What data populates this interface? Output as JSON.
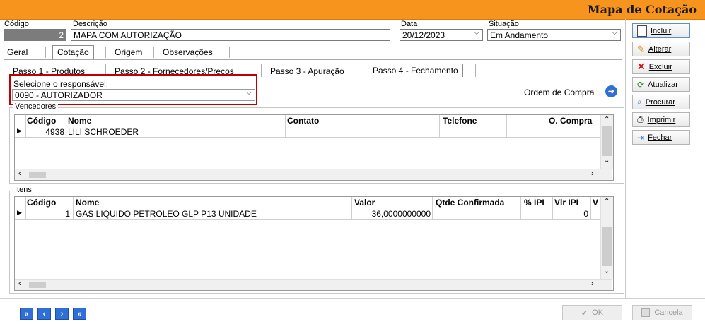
{
  "window": {
    "title": "Mapa de Cotação"
  },
  "header": {
    "codigo_label": "Código",
    "codigo_value": "2",
    "descricao_label": "Descrição",
    "descricao_value": "MAPA COM AUTORIZAÇÃO",
    "data_label": "Data",
    "data_value": "20/12/2023",
    "situacao_label": "Situação",
    "situacao_value": "Em Andamento"
  },
  "tabs": [
    "Geral",
    "Cotação",
    "Origem",
    "Observações"
  ],
  "active_tab": "Cotação",
  "steps": [
    "Passo 1 - Produtos",
    "Passo 2 - Fornecedores/Preços",
    "Passo 3 - Apuração",
    "Passo 4 - Fechamento"
  ],
  "active_step": "Passo 4 - Fechamento",
  "responsavel": {
    "label": "Selecione o responsável:",
    "value": "0090 - AUTORIZADOR"
  },
  "ordem_compra": {
    "label": "Ordem de Compra"
  },
  "vendedores": {
    "title": "Vencedores",
    "columns": [
      "Código",
      "Nome",
      "Contato",
      "Telefone",
      "O. Compra"
    ],
    "rows": [
      {
        "codigo": "4938",
        "nome": "LILI SCHROEDER",
        "contato": "",
        "telefone": "",
        "ocompra": ""
      }
    ]
  },
  "itens": {
    "title": "Itens",
    "columns": [
      "Código",
      "Nome",
      "Valor",
      "Qtde Confirmada",
      "% IPI",
      "Vlr IPI",
      "V"
    ],
    "rows": [
      {
        "codigo": "1",
        "nome": "GAS LIQUIDO PETROLEO GLP P13 UNIDADE",
        "valor": "36,0000000000",
        "qtde": "",
        "ipi": "",
        "vlr_ipi": "0"
      }
    ]
  },
  "side_buttons": {
    "incluir": "Incluir",
    "alterar": "Alterar",
    "excluir": "Excluir",
    "atualizar": "Atualizar",
    "procurar": "Procurar",
    "imprimir": "Imprimir",
    "fechar": "Fechar"
  },
  "bottom_buttons": {
    "ok": "OK",
    "cancela": "Cancela"
  },
  "colors": {
    "title_bar": "#f7941d",
    "highlight_border": "#c00000",
    "nav_blue": "#2f6fd6"
  }
}
